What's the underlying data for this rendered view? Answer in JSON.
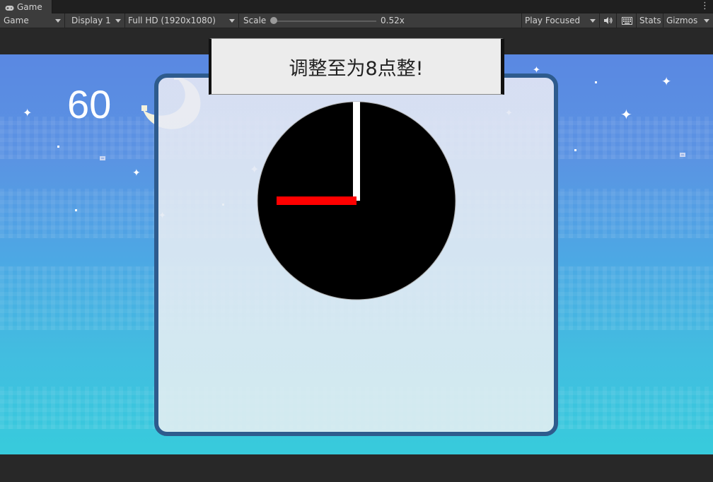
{
  "editor": {
    "tab_label": "Game",
    "toolbar": {
      "mode": "Game",
      "display": "Display 1",
      "resolution": "Full HD (1920x1080)",
      "scale_label": "Scale",
      "scale_value": "0.52x",
      "play_mode": "Play Focused",
      "stats": "Stats",
      "gizmos": "Gizmos"
    }
  },
  "game": {
    "timer": "60",
    "instruction": "调整至为8点整!",
    "clock": {
      "hour_hand_hour": 9,
      "minute_hand_minute": 0,
      "face_color": "#000000",
      "hour_hand_color": "#ff0000",
      "minute_hand_color": "#ffffff"
    },
    "colors": {
      "sky_top": "#5a88e2",
      "sky_bottom": "#37cbdc",
      "panel_border": "#2e5b8d"
    }
  }
}
